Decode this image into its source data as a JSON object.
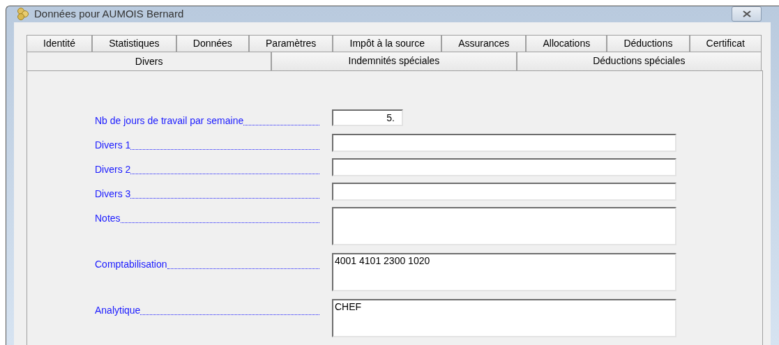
{
  "window": {
    "title": "Données pour AUMOIS Bernard"
  },
  "tab_rows": [
    [
      {
        "label": "Identité",
        "selected": false
      },
      {
        "label": "Statistiques",
        "selected": false
      },
      {
        "label": "Données",
        "selected": false
      },
      {
        "label": "Paramètres",
        "selected": false
      },
      {
        "label": "Impôt à la source",
        "selected": false
      },
      {
        "label": "Assurances",
        "selected": false
      },
      {
        "label": "Allocations",
        "selected": false
      },
      {
        "label": "Déductions",
        "selected": false
      },
      {
        "label": "Certificat",
        "selected": false
      }
    ],
    [
      {
        "label": "Divers",
        "selected": true
      },
      {
        "label": "Indemnités spéciales",
        "selected": false
      },
      {
        "label": "Déductions spéciales",
        "selected": false
      }
    ]
  ],
  "fields": [
    {
      "label": "Nb de jours de travail par semaine",
      "kind": "short",
      "value": "5."
    },
    {
      "label": "Divers 1",
      "kind": "line"
    },
    {
      "label": "Divers 2",
      "kind": "line"
    },
    {
      "label": "Divers 3",
      "kind": "line"
    },
    {
      "label": "Notes",
      "kind": "multi"
    },
    {
      "label": "Comptabilisation",
      "kind": "multi",
      "value": "4001 4101 2300 1020"
    },
    {
      "label": "Analytique",
      "kind": "multi",
      "value": "CHEF"
    }
  ]
}
